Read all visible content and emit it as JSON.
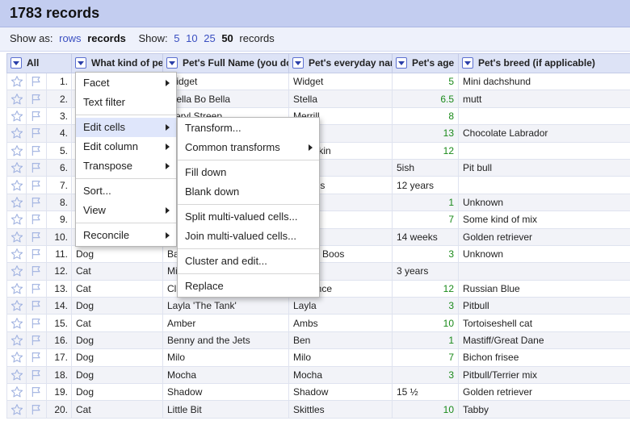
{
  "header": {
    "title": "1783 records"
  },
  "toolbar": {
    "show_as_label": "Show as:",
    "rows_link": "rows",
    "records_current": "records",
    "show_label": "Show:",
    "page_sizes": [
      "5",
      "10",
      "25"
    ],
    "page_size_current": "50",
    "records_suffix": "records"
  },
  "columns": {
    "all": "All",
    "kind": "What kind of pet",
    "full_name": "Pet's Full Name (you don't",
    "everyday_name": "Pet's everyday name",
    "age": "Pet's age",
    "breed": "Pet's breed (if applicable)"
  },
  "rows": [
    {
      "idx": "1.",
      "kind": "",
      "full_name": "Widget",
      "everyday": "Widget",
      "age": "5",
      "age_text": "",
      "breed": "Mini dachshund"
    },
    {
      "idx": "2.",
      "kind": "",
      "full_name": "Stella Bo Bella",
      "everyday": "Stella",
      "age": "6.5",
      "age_text": "",
      "breed": "mutt"
    },
    {
      "idx": "3.",
      "kind": "",
      "full_name": "Meryl Streep",
      "everyday": "Merrill",
      "age": "8",
      "age_text": "",
      "breed": ""
    },
    {
      "idx": "4.",
      "kind": "",
      "full_name": "",
      "everyday": "",
      "age": "13",
      "age_text": "",
      "breed": "Chocolate Labrador"
    },
    {
      "idx": "5.",
      "kind": "",
      "full_name": "",
      "everyday": "Pumpkin",
      "age": "12",
      "age_text": "",
      "breed": ""
    },
    {
      "idx": "6.",
      "kind": "",
      "full_name": "",
      "everyday": "",
      "age": "",
      "age_text": "5ish",
      "breed": "Pit bull"
    },
    {
      "idx": "7.",
      "kind": "",
      "full_name": "",
      "everyday": "Bosses",
      "age": "",
      "age_text": "12 years",
      "breed": ""
    },
    {
      "idx": "8.",
      "kind": "",
      "full_name": "",
      "everyday": "",
      "age": "1",
      "age_text": "",
      "breed": "Unknown"
    },
    {
      "idx": "9.",
      "kind": "",
      "full_name": "",
      "everyday": "",
      "age": "7",
      "age_text": "",
      "breed": "Some kind of mix"
    },
    {
      "idx": "10.",
      "kind": "",
      "full_name": "",
      "everyday": "",
      "age": "",
      "age_text": "14 weeks",
      "breed": "Golden retriever"
    },
    {
      "idx": "11.",
      "kind": "Dog",
      "full_name": "Bailey",
      "everyday": "Bailey Boos",
      "age": "3",
      "age_text": "",
      "breed": "Unknown"
    },
    {
      "idx": "12.",
      "kind": "Cat",
      "full_name": "Mittens",
      "everyday": "",
      "age": "",
      "age_text": "3 years",
      "breed": ""
    },
    {
      "idx": "13.",
      "kind": "Cat",
      "full_name": "Clarence",
      "everyday": "Clarence",
      "age": "12",
      "age_text": "",
      "breed": "Russian Blue"
    },
    {
      "idx": "14.",
      "kind": "Dog",
      "full_name": "Layla 'The Tank'",
      "everyday": "Layla",
      "age": "3",
      "age_text": "",
      "breed": "Pitbull"
    },
    {
      "idx": "15.",
      "kind": "Cat",
      "full_name": "Amber",
      "everyday": "Ambs",
      "age": "10",
      "age_text": "",
      "breed": "Tortoiseshell cat"
    },
    {
      "idx": "16.",
      "kind": "Dog",
      "full_name": "Benny and the Jets",
      "everyday": "Ben",
      "age": "1",
      "age_text": "",
      "breed": "Mastiff/Great Dane"
    },
    {
      "idx": "17.",
      "kind": "Dog",
      "full_name": "Milo",
      "everyday": "Milo",
      "age": "7",
      "age_text": "",
      "breed": "Bichon frisee"
    },
    {
      "idx": "18.",
      "kind": "Dog",
      "full_name": "Mocha",
      "everyday": "Mocha",
      "age": "3",
      "age_text": "",
      "breed": "Pitbull/Terrier mix"
    },
    {
      "idx": "19.",
      "kind": "Dog",
      "full_name": "Shadow",
      "everyday": "Shadow",
      "age": "",
      "age_text": "15 ½",
      "breed": "Golden retriever"
    },
    {
      "idx": "20.",
      "kind": "Cat",
      "full_name": "Little Bit",
      "everyday": "Skittles",
      "age": "10",
      "age_text": "",
      "breed": "Tabby"
    }
  ],
  "column_menu": {
    "facet": "Facet",
    "text_filter": "Text filter",
    "edit_cells": "Edit cells",
    "edit_column": "Edit column",
    "transpose": "Transpose",
    "sort": "Sort...",
    "view": "View",
    "reconcile": "Reconcile"
  },
  "edit_cells_menu": {
    "transform": "Transform...",
    "common_transforms": "Common transforms",
    "fill_down": "Fill down",
    "blank_down": "Blank down",
    "split_multi": "Split multi-valued cells...",
    "join_multi": "Join multi-valued cells...",
    "cluster_edit": "Cluster and edit...",
    "replace": "Replace"
  },
  "colors": {
    "header_bg": "#c3cdf0",
    "toolbar_bg": "#eef1fb",
    "column_header_bg": "#dde3f6",
    "link": "#3a4fc1",
    "number": "#1a8a1a",
    "menu_highlight": "#dfe6fb",
    "star_icon": "#9fb1e0"
  }
}
